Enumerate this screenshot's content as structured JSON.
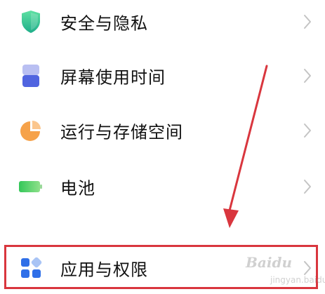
{
  "settings": {
    "items": [
      {
        "id": "security",
        "label": "安全与隐私",
        "icon": "shield-icon"
      },
      {
        "id": "screen-time",
        "label": "屏幕使用时间",
        "icon": "hourglass-icon"
      },
      {
        "id": "storage",
        "label": "运行与存储空间",
        "icon": "pie-chart-icon"
      },
      {
        "id": "battery",
        "label": "电池",
        "icon": "battery-icon"
      },
      {
        "id": "apps",
        "label": "应用与权限",
        "icon": "apps-grid-icon"
      }
    ]
  },
  "annotation": {
    "highlight_color": "#d9363e",
    "target": "应用与权限"
  },
  "watermark": {
    "text": "Baidu",
    "sub": "jingyan.baidu.com"
  }
}
